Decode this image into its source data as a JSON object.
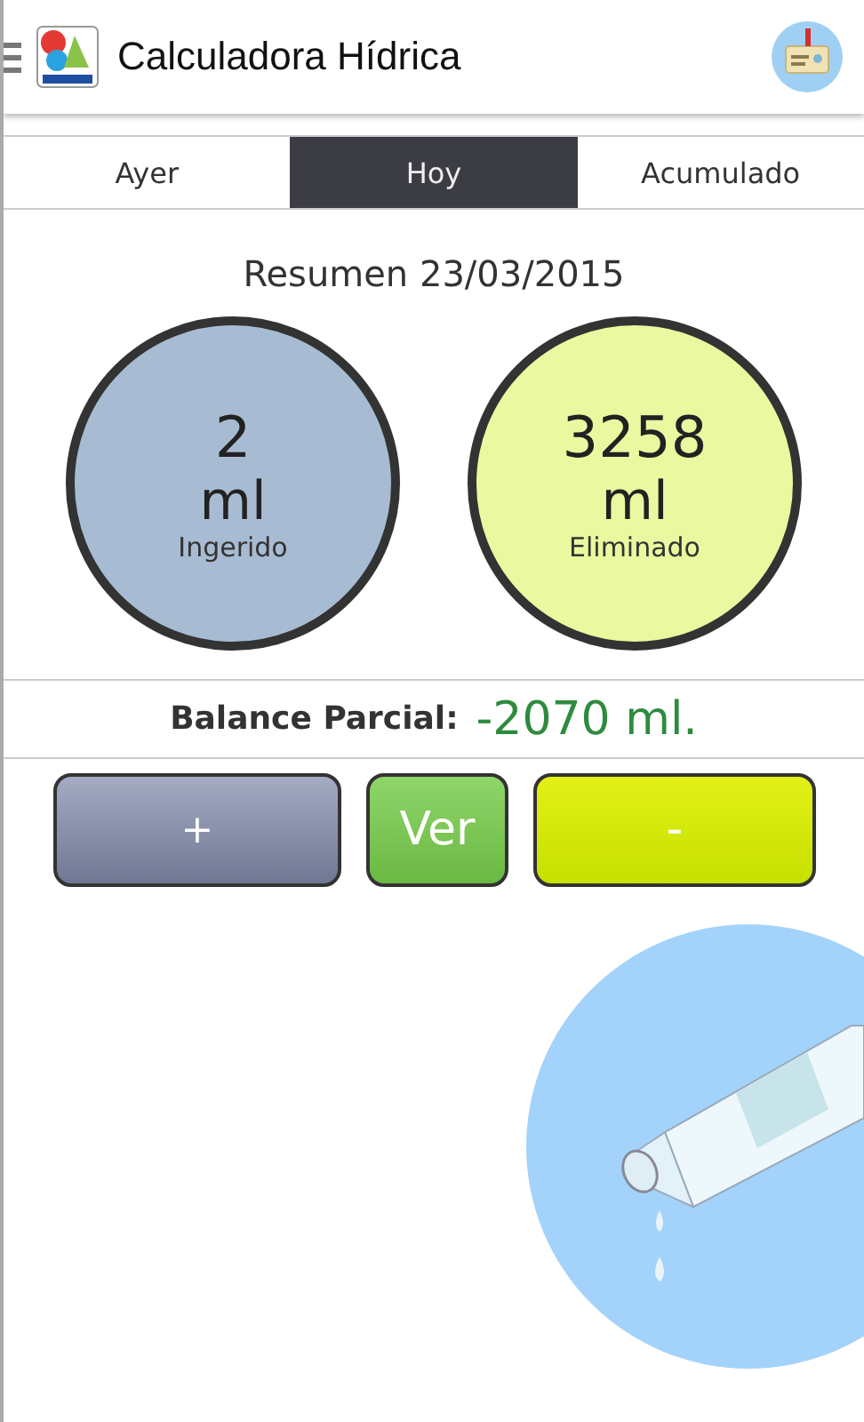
{
  "app_bar": {
    "title": "Calculadora Hídrica"
  },
  "tabs": [
    {
      "label": "Ayer",
      "selected": false
    },
    {
      "label": "Hoy",
      "selected": true
    },
    {
      "label": "Acumulado",
      "selected": false
    }
  ],
  "summary_title": "Resumen 23/03/2015",
  "totals": [
    {
      "amount": "2",
      "unit": "ml",
      "label": "Ingerido",
      "color": "#a7bcd3"
    },
    {
      "amount": "3258",
      "unit": "ml",
      "label": "Eliminado",
      "color": "#eaf99f"
    }
  ],
  "balance": {
    "label": "Balance Parcial:",
    "value": "-2070 ml."
  },
  "buttons": [
    {
      "label": "+",
      "kind": "add"
    },
    {
      "label": "Ver",
      "kind": "view"
    },
    {
      "label": "-",
      "kind": "remove"
    }
  ]
}
